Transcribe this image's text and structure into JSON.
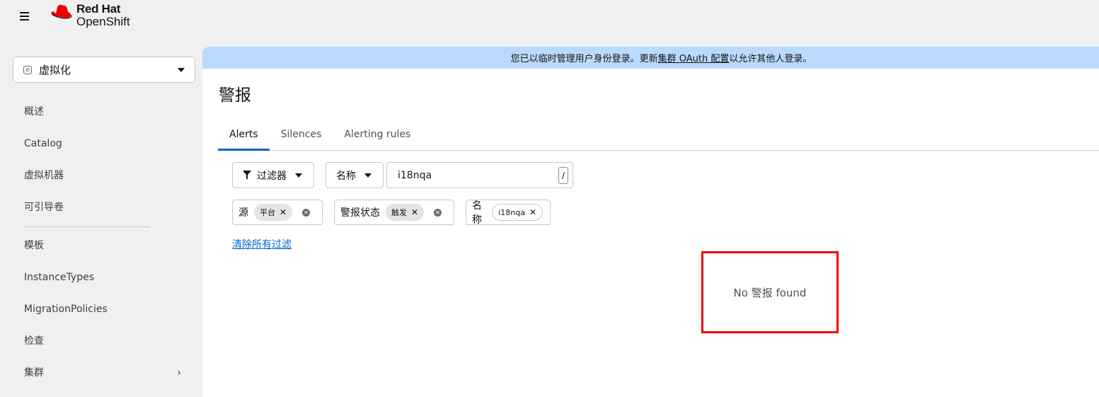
{
  "header": {
    "brand": "Red Hat",
    "product": "OpenShift"
  },
  "sidebar": {
    "perspective": "虚拟化",
    "items": [
      {
        "label": "概述"
      },
      {
        "label": "Catalog"
      },
      {
        "label": "虚拟机器"
      },
      {
        "label": "可引导卷"
      },
      {
        "label": "模板"
      },
      {
        "label": "InstanceTypes"
      },
      {
        "label": "MigrationPolicies"
      },
      {
        "label": "检查"
      },
      {
        "label": "集群"
      }
    ]
  },
  "banner": {
    "prefix": "您已以临时管理用户身份登录。更新",
    "link": "集群 OAuth 配置",
    "suffix": "以允许其他人登录。"
  },
  "page": {
    "title": "警报",
    "tabs": [
      "Alerts",
      "Silences",
      "Alerting rules"
    ]
  },
  "toolbar": {
    "filter_label": "过滤器",
    "attribute_label": "名称",
    "search_value": "i18nqa",
    "search_shortcut": "/"
  },
  "chips": [
    {
      "category": "源",
      "value": "平台"
    },
    {
      "category": "警报状态",
      "value": "触发"
    },
    {
      "category": "名称",
      "value": "i18nqa"
    }
  ],
  "clear_filters": "清除所有过滤",
  "empty_state": "No 警报 found",
  "colors": {
    "banner": "#b9dafc",
    "accent": "#0066cc",
    "highlight": "#ee0000"
  }
}
